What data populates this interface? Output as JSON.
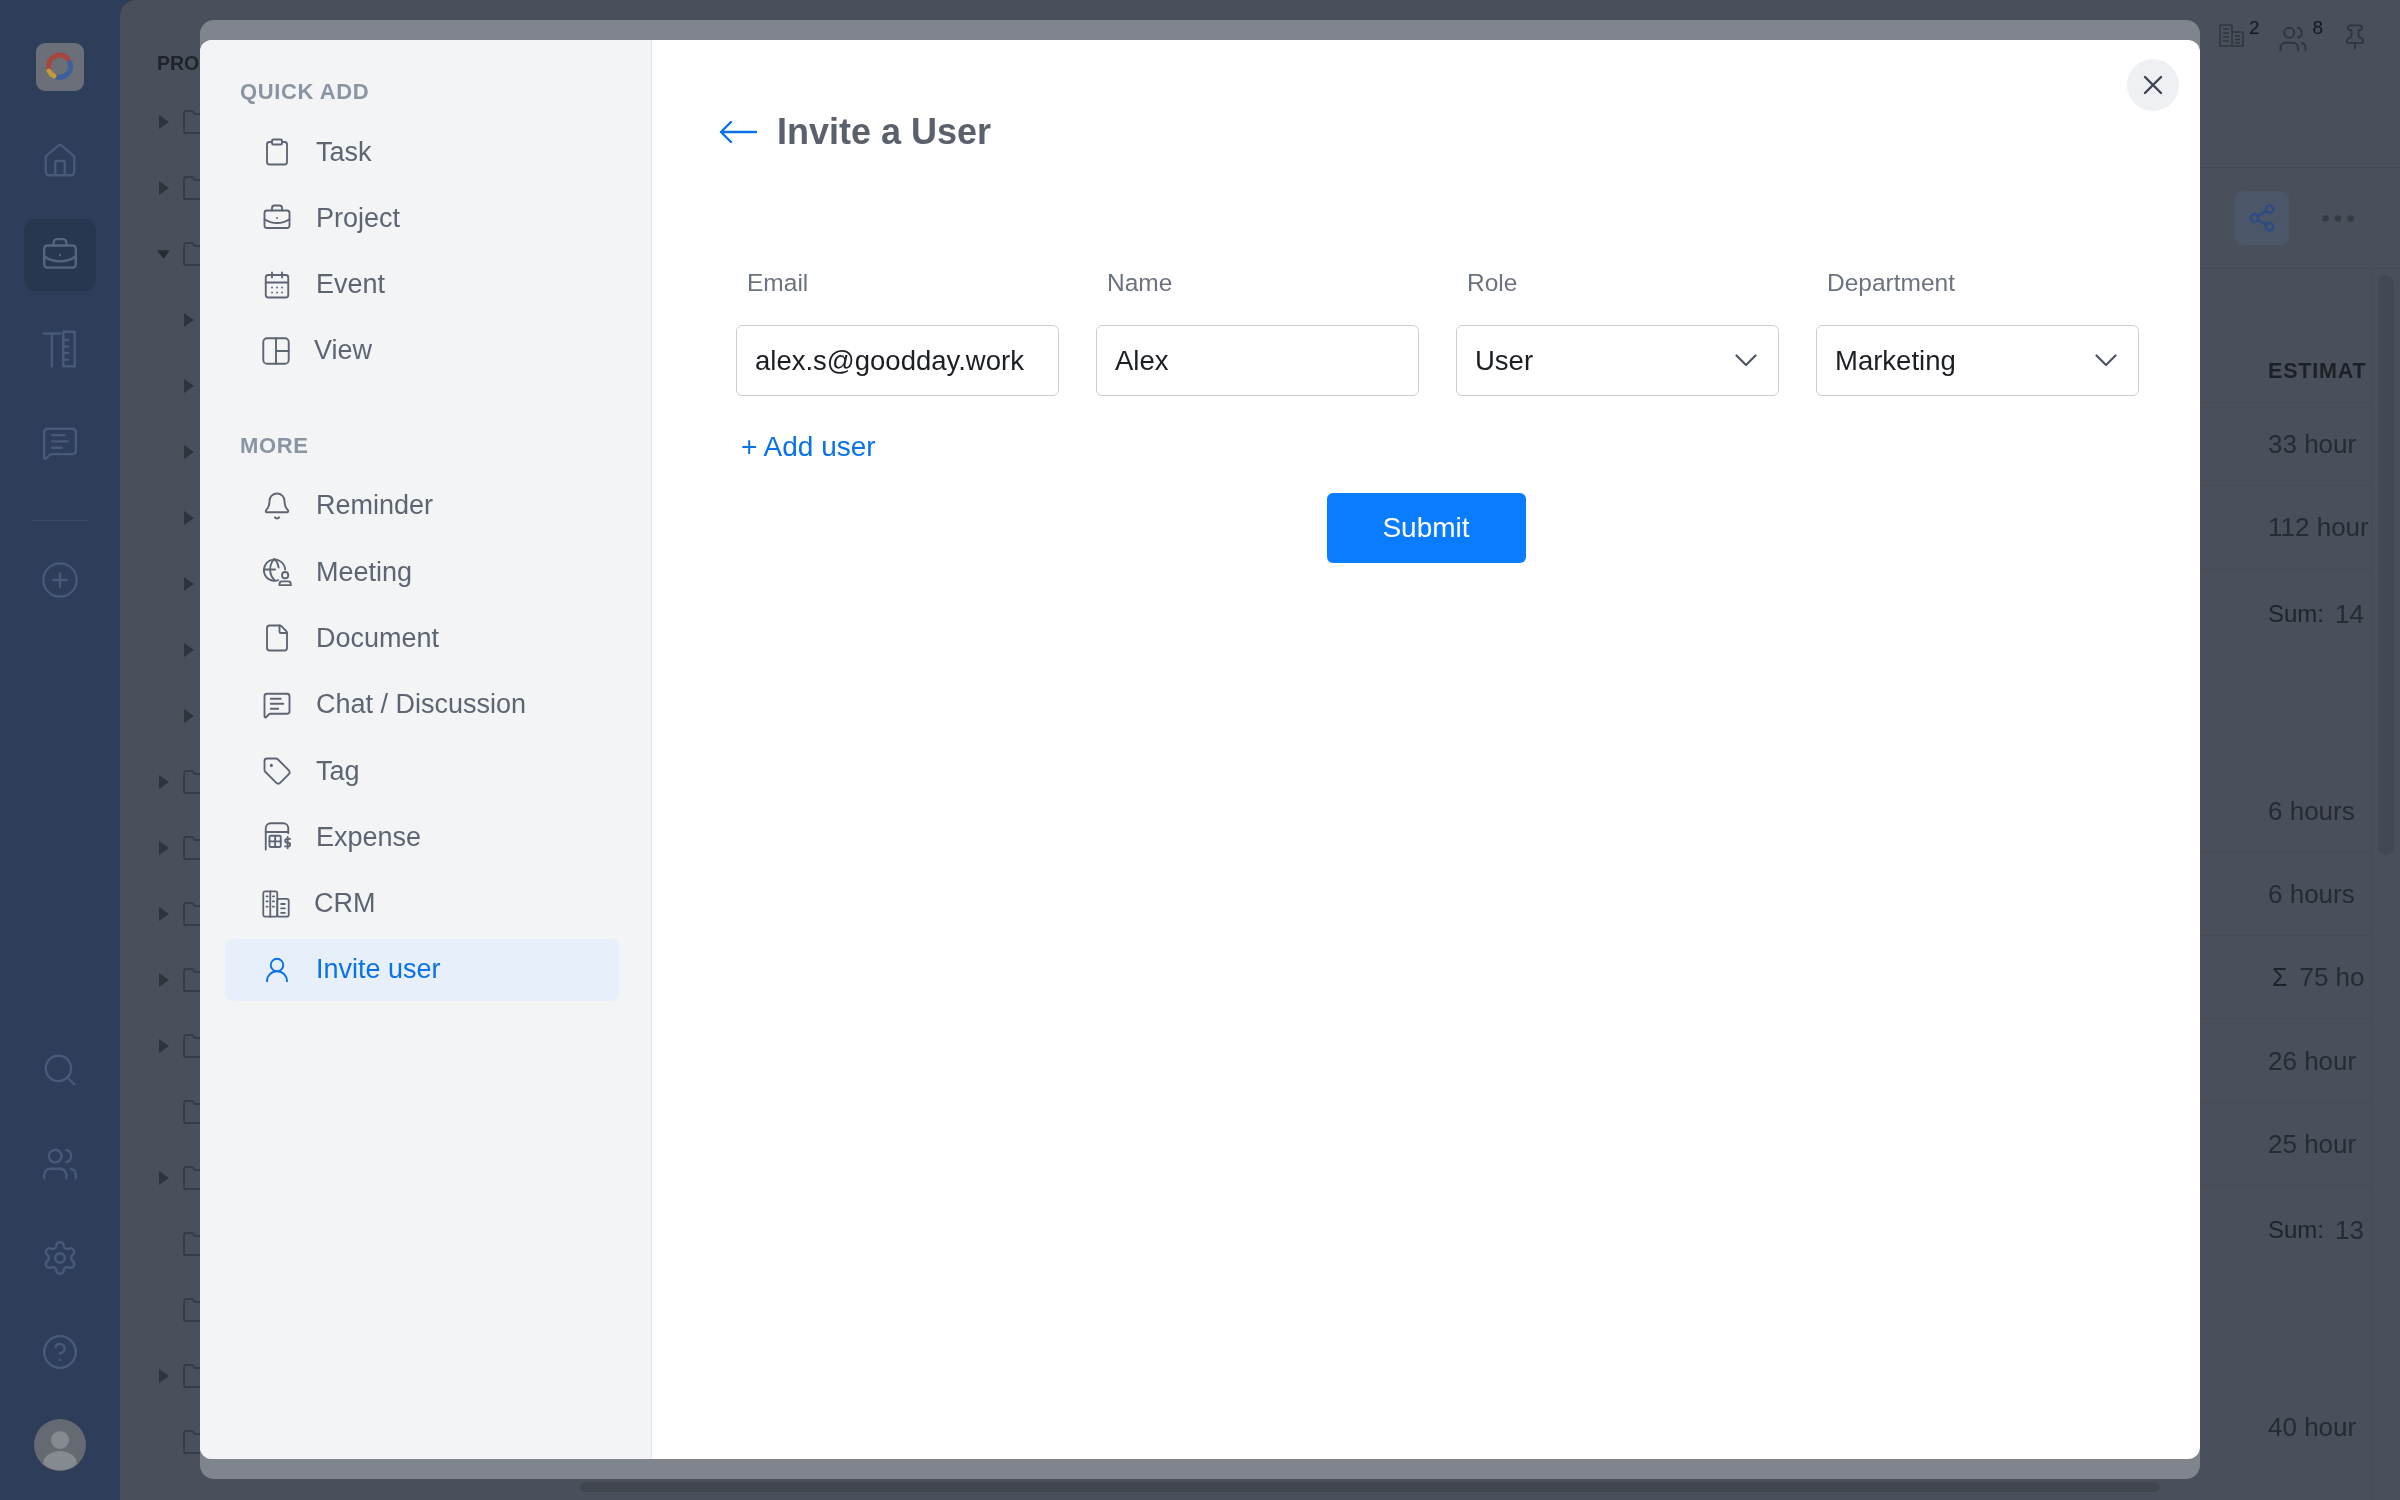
{
  "app_sidebar": {
    "nav": [
      {
        "selected": false
      },
      {
        "selected": true
      },
      {
        "selected": false
      },
      {
        "selected": false
      }
    ]
  },
  "tree": {
    "heading": "PRO",
    "rows": [
      {
        "kind": "group",
        "expanded": false
      },
      {
        "kind": "group",
        "expanded": false
      },
      {
        "kind": "group",
        "expanded": true,
        "children": [
          {
            "kind": "group",
            "expanded": false
          },
          {
            "kind": "group",
            "expanded": false
          },
          {
            "kind": "group",
            "expanded": false
          },
          {
            "kind": "group",
            "expanded": false
          },
          {
            "kind": "group",
            "expanded": false
          },
          {
            "kind": "group",
            "expanded": false
          },
          {
            "kind": "group",
            "expanded": false
          }
        ]
      },
      {
        "kind": "group",
        "expanded": false
      },
      {
        "kind": "group",
        "expanded": false
      },
      {
        "kind": "group",
        "expanded": false
      },
      {
        "kind": "group",
        "expanded": false
      },
      {
        "kind": "group",
        "expanded": false
      },
      {
        "kind": "leaf"
      },
      {
        "kind": "group",
        "expanded": false
      },
      {
        "kind": "leaf"
      },
      {
        "kind": "leaf"
      },
      {
        "kind": "group",
        "expanded": false
      },
      {
        "kind": "leaf"
      }
    ]
  },
  "header_stats": [
    {
      "count": "2"
    },
    {
      "count": "8"
    }
  ],
  "toolbar": [
    {
      "selected": true
    },
    {
      "selected": false
    }
  ],
  "table": {
    "column": "ESTIMAT",
    "rows": [
      {
        "kind": "value",
        "text": "33 hour"
      },
      {
        "kind": "value",
        "text": "112 hour"
      },
      {
        "kind": "sum",
        "label": "Sum:",
        "text": "14"
      },
      {
        "kind": "value",
        "text": "6 hours"
      },
      {
        "kind": "value",
        "text": "6 hours"
      },
      {
        "kind": "total",
        "symbol": "Σ",
        "text": "75 ho"
      },
      {
        "kind": "value",
        "text": "26 hour"
      },
      {
        "kind": "value",
        "text": "25 hour"
      },
      {
        "kind": "sum",
        "label": "Sum:",
        "text": "13"
      },
      {
        "kind": "value",
        "text": "40 hour"
      }
    ]
  },
  "dialog": {
    "quick_add": {
      "heading": "QUICK ADD",
      "items": [
        {
          "label": "Task",
          "selected": false
        },
        {
          "label": "Project",
          "selected": false
        },
        {
          "label": "Event",
          "selected": false
        },
        {
          "label": "View",
          "selected": false
        }
      ]
    },
    "more": {
      "heading": "MORE",
      "items": [
        {
          "label": "Reminder",
          "selected": false
        },
        {
          "label": "Meeting",
          "selected": false
        },
        {
          "label": "Document",
          "selected": false
        },
        {
          "label": "Chat / Discussion",
          "selected": false
        },
        {
          "label": "Tag",
          "selected": false
        },
        {
          "label": "Expense",
          "selected": false
        },
        {
          "label": "CRM",
          "selected": false
        },
        {
          "label": "Invite user",
          "selected": true
        }
      ]
    },
    "title": "Invite a User",
    "fields": [
      {
        "kind": "text",
        "label": "Email",
        "value": "alex.s@goodday.work"
      },
      {
        "kind": "text",
        "label": "Name",
        "value": "Alex"
      },
      {
        "kind": "select",
        "label": "Role",
        "value": "User"
      },
      {
        "kind": "select",
        "label": "Department",
        "value": "Marketing"
      }
    ],
    "add_link": "+ Add user",
    "submit": "Submit"
  }
}
